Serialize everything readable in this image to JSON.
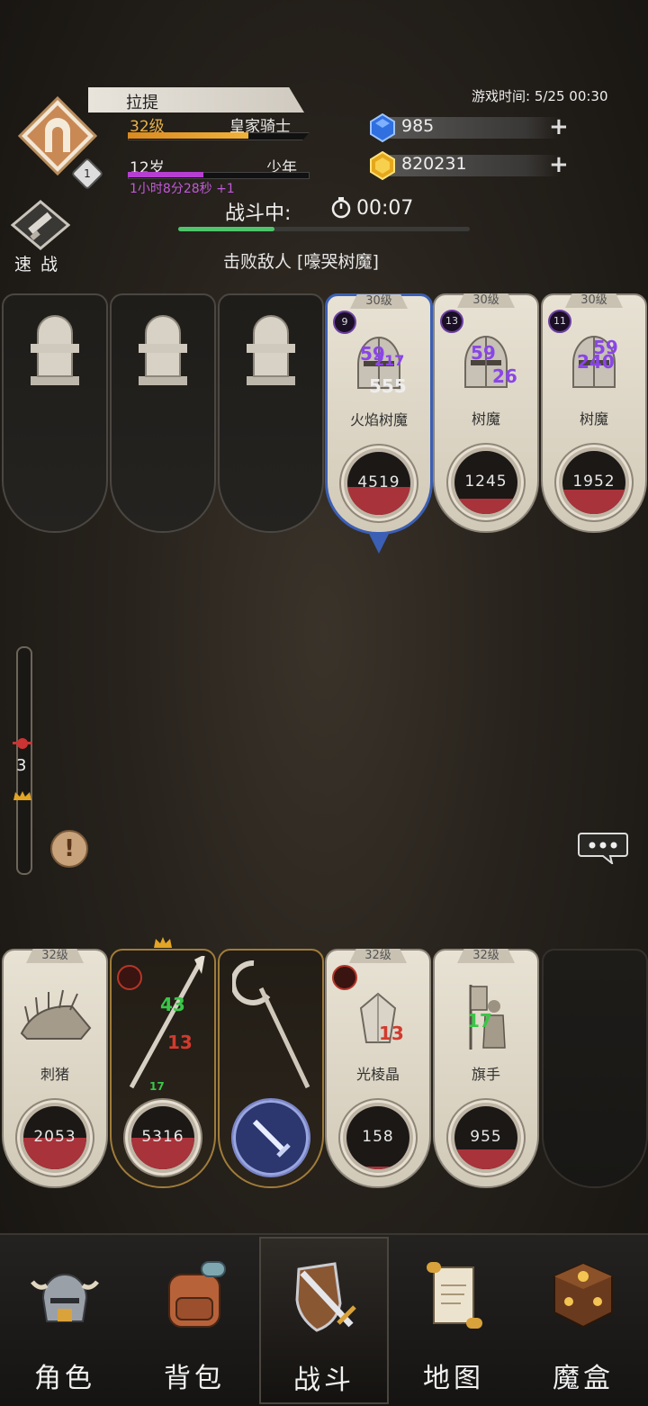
{
  "player": {
    "name": "拉提",
    "level": "32级",
    "class": "皇家骑士",
    "xp_fraction": 0.67,
    "age": "12岁",
    "age_stage": "少年",
    "age_fraction": 0.42,
    "age_timer": "1小时8分28秒 +1",
    "rank_badge_number": "1"
  },
  "game_time": "游戏时间: 5/25 00:30",
  "currency": {
    "gems": "985",
    "gold": "820231",
    "plus": "+"
  },
  "speed_battle_label": "速 战",
  "battle": {
    "status": "战斗中:",
    "timer": "00:07",
    "progress_fraction": 0.33,
    "objective": "击败敌人 [嚎哭树魔]"
  },
  "enemies": [
    {
      "type": "tombstone"
    },
    {
      "type": "tombstone"
    },
    {
      "type": "tombstone"
    },
    {
      "type": "enemy",
      "level": "30级",
      "name": "火焰树魔",
      "hp": "4519",
      "hp_fraction": 0.45,
      "status_count": "9",
      "floating": [
        "59",
        "217",
        "555"
      ]
    },
    {
      "type": "enemy",
      "level": "30级",
      "name": "树魔",
      "hp": "1245",
      "hp_fraction": 0.25,
      "status_count": "13",
      "floating": [
        "59",
        "26"
      ]
    },
    {
      "type": "enemy",
      "level": "30级",
      "name": "树魔",
      "hp": "1952",
      "hp_fraction": 0.38,
      "status_count": "11",
      "floating": [
        "59",
        "240"
      ]
    }
  ],
  "allies": [
    {
      "level": "32级",
      "name": "刺猪",
      "hp": "2053",
      "hp_fraction": 0.5
    },
    {
      "level": "",
      "name": "",
      "hp": "5316",
      "hp_fraction": 0.5,
      "floating_green": "43",
      "floating_red": "13",
      "small_green": "17"
    },
    {
      "level": "",
      "name": "",
      "hp": "",
      "hp_fraction": 0
    },
    {
      "level": "32级",
      "name": "光棱晶",
      "hp": "158",
      "hp_fraction": 0.05,
      "floating_red": "13"
    },
    {
      "level": "32级",
      "name": "旗手",
      "hp": "955",
      "hp_fraction": 0.32,
      "floating_green": "17"
    }
  ],
  "gauge_level": "3",
  "alert_symbol": "!",
  "nav": [
    {
      "label": "角色",
      "icon": "helmet-icon"
    },
    {
      "label": "背包",
      "icon": "backpack-icon"
    },
    {
      "label": "战斗",
      "icon": "sword-shield-icon",
      "active": true
    },
    {
      "label": "地图",
      "icon": "scroll-map-icon"
    },
    {
      "label": "魔盒",
      "icon": "magic-box-icon"
    }
  ]
}
